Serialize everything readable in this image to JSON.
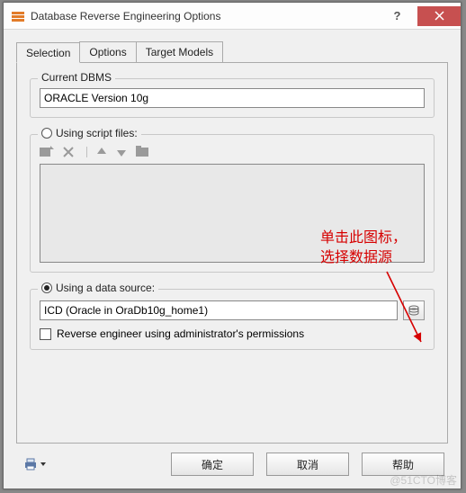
{
  "window": {
    "title": "Database Reverse Engineering Options"
  },
  "tabs": {
    "selection": "Selection",
    "options": "Options",
    "target_models": "Target Models"
  },
  "current_dbms": {
    "label": "Current DBMS",
    "value": "ORACLE Version 10g"
  },
  "script": {
    "label": "Using script files:"
  },
  "data_source": {
    "label": "Using a data source:",
    "value": "ICD (Oracle in OraDb10g_home1)",
    "reverse_engineer_label": "Reverse engineer using administrator's permissions"
  },
  "buttons": {
    "ok": "确定",
    "cancel": "取消",
    "help": "帮助"
  },
  "annotation": {
    "line1": "单击此图标，",
    "line2": "选择数据源"
  },
  "watermark": "@51CTO博客"
}
